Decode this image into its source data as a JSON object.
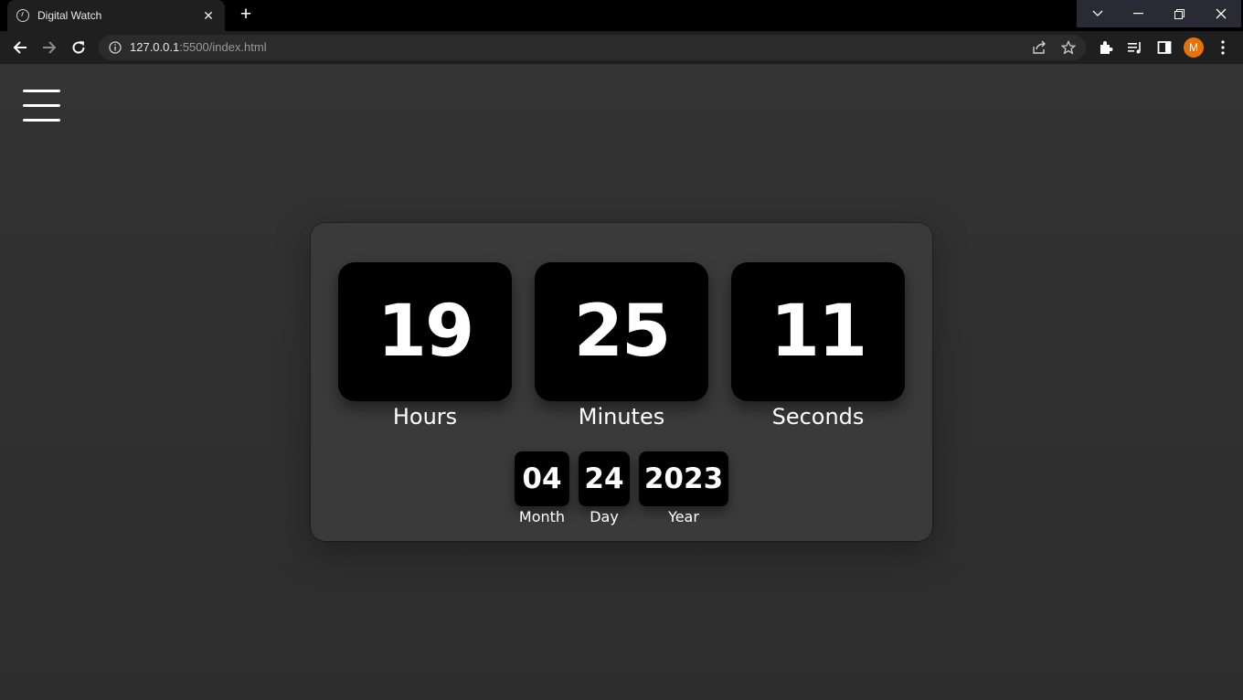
{
  "browser": {
    "tab_title": "Digital Watch",
    "tab_close": "✕",
    "new_tab": "+",
    "url_host": "127.0.0.1",
    "url_rest": ":5500/index.html",
    "avatar_letter": "M",
    "avatar_color": "#e8710a"
  },
  "watch": {
    "hours": "19",
    "minutes": "25",
    "seconds": "11",
    "hours_label": "Hours",
    "minutes_label": "Minutes",
    "seconds_label": "Seconds",
    "month": "04",
    "day": "24",
    "year": "2023",
    "month_label": "Month",
    "day_label": "Day",
    "year_label": "Year"
  }
}
